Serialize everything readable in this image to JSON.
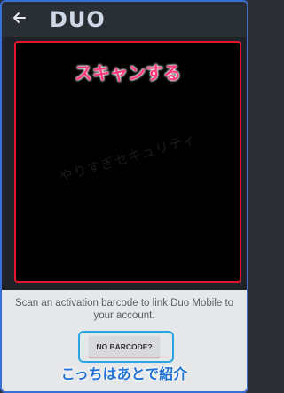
{
  "appbar": {
    "back_icon": "arrow-left-icon",
    "logo_text": "DUO"
  },
  "scanner": {
    "title": "スキャンする",
    "watermark": "やりすぎセキュリティ",
    "frame_color": "#e3162f"
  },
  "bottom": {
    "instruction": "Scan an activation barcode to link Duo Mobile to your account.",
    "no_barcode_label": "NO BARCODE?",
    "note": "こっちはあとで紹介",
    "highlight_color": "#2aa5e6"
  }
}
